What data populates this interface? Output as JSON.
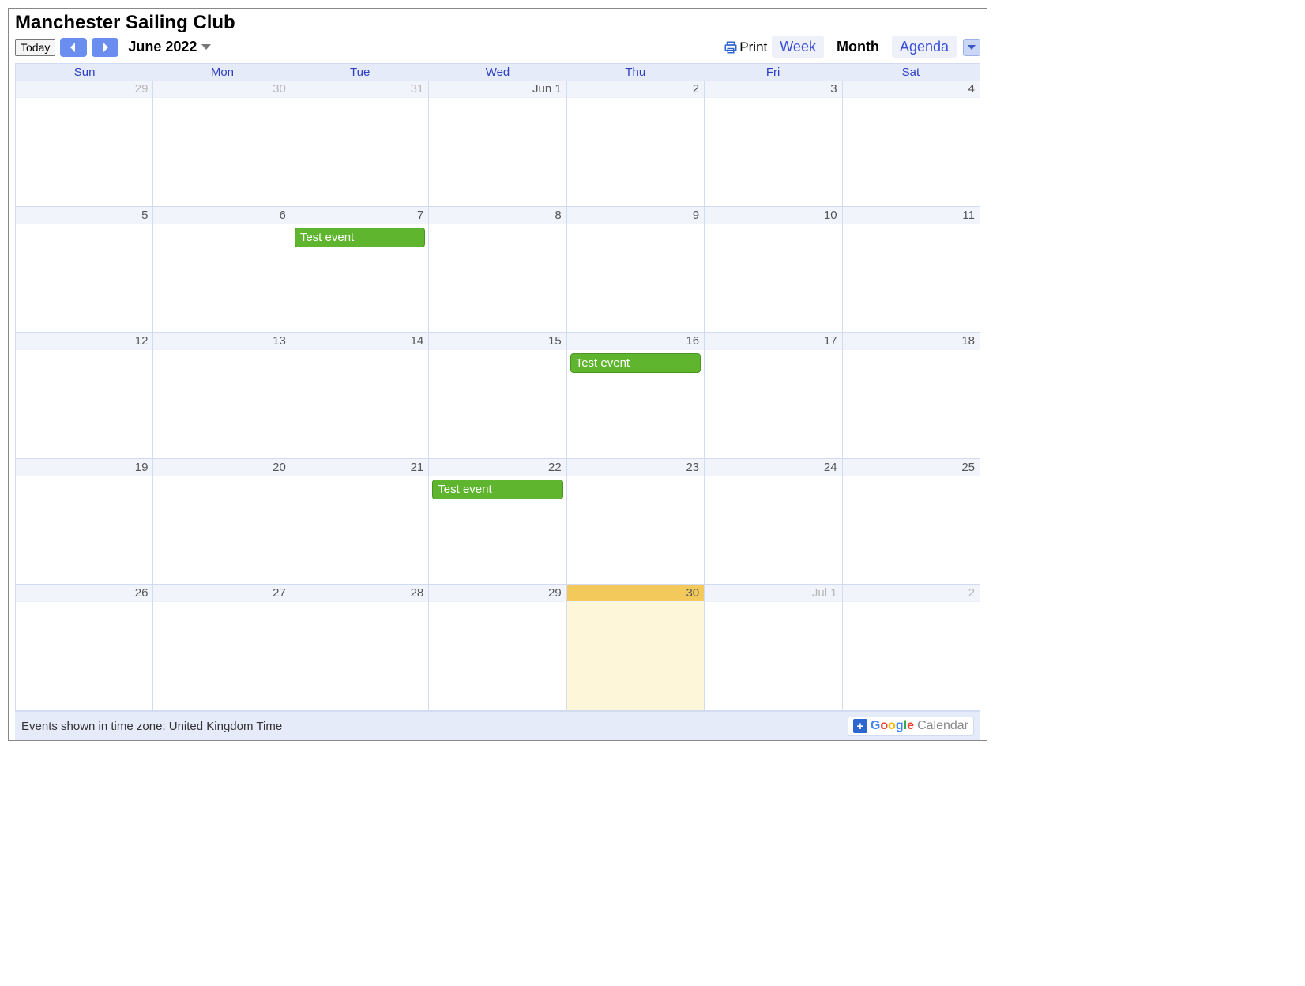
{
  "title": "Manchester Sailing Club",
  "toolbar": {
    "today": "Today",
    "month_label": "June 2022",
    "print": "Print",
    "views": {
      "week": "Week",
      "month": "Month",
      "agenda": "Agenda"
    },
    "active_view": "month"
  },
  "days_of_week": [
    "Sun",
    "Mon",
    "Tue",
    "Wed",
    "Thu",
    "Fri",
    "Sat"
  ],
  "cells": [
    {
      "label": "29",
      "other": true
    },
    {
      "label": "30",
      "other": true
    },
    {
      "label": "31",
      "other": true
    },
    {
      "label": "Jun 1"
    },
    {
      "label": "2"
    },
    {
      "label": "3"
    },
    {
      "label": "4"
    },
    {
      "label": "5"
    },
    {
      "label": "6"
    },
    {
      "label": "7",
      "events": [
        "Test event"
      ]
    },
    {
      "label": "8"
    },
    {
      "label": "9"
    },
    {
      "label": "10"
    },
    {
      "label": "11"
    },
    {
      "label": "12"
    },
    {
      "label": "13"
    },
    {
      "label": "14"
    },
    {
      "label": "15"
    },
    {
      "label": "16",
      "events": [
        "Test event"
      ]
    },
    {
      "label": "17"
    },
    {
      "label": "18"
    },
    {
      "label": "19"
    },
    {
      "label": "20"
    },
    {
      "label": "21"
    },
    {
      "label": "22",
      "events": [
        "Test event"
      ]
    },
    {
      "label": "23"
    },
    {
      "label": "24"
    },
    {
      "label": "25"
    },
    {
      "label": "26"
    },
    {
      "label": "27"
    },
    {
      "label": "28"
    },
    {
      "label": "29"
    },
    {
      "label": "30",
      "today": true
    },
    {
      "label": "Jul 1",
      "other": true
    },
    {
      "label": "2",
      "other": true
    }
  ],
  "footer": {
    "tz_text": "Events shown in time zone: United Kingdom Time",
    "google": {
      "g": "G",
      "o1": "o",
      "o2": "o",
      "g2": "g",
      "l": "l",
      "e": "e",
      "cal": "Calendar"
    }
  }
}
